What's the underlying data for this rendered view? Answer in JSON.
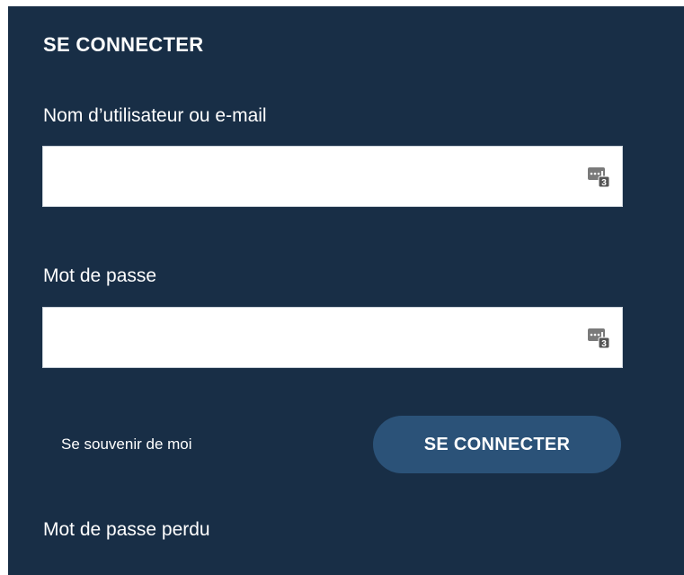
{
  "form": {
    "title": "SE CONNECTER",
    "username": {
      "label": "Nom d’utilisateur ou e-mail",
      "value": "",
      "placeholder": ""
    },
    "password": {
      "label": "Mot de passe",
      "value": "",
      "placeholder": ""
    },
    "field_icon": "password-manager-icon",
    "field_icon_badge": "3",
    "remember_label": "Se souvenir de moi",
    "submit_label": "SE CONNECTER",
    "lost_password_label": "Mot de passe perdu"
  },
  "colors": {
    "panel_background": "#182e46",
    "button_background": "#2b5278",
    "text": "#ffffff"
  }
}
